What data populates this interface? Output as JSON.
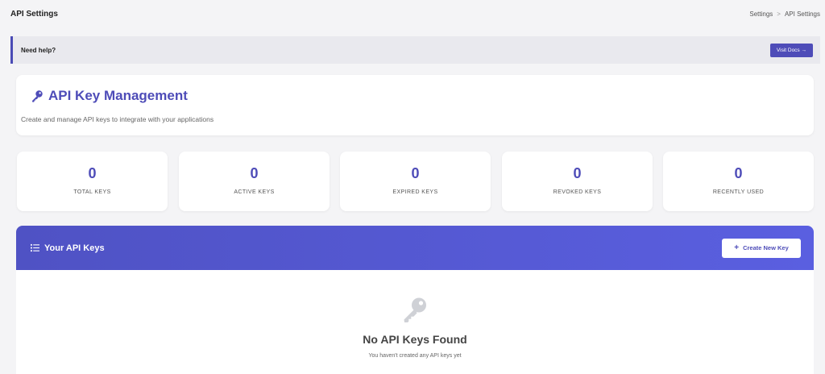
{
  "header": {
    "title": "API Settings",
    "breadcrumb": [
      "Settings",
      "API Settings"
    ],
    "breadcrumb_separator": ">"
  },
  "help": {
    "text": "Need help?",
    "docs_button": "Visit Docs →"
  },
  "management": {
    "icon": "key-icon",
    "title": "API Key Management",
    "subtitle": "Create and manage API keys to integrate with your applications"
  },
  "stats": [
    {
      "value": "0",
      "label": "TOTAL KEYS"
    },
    {
      "value": "0",
      "label": "ACTIVE KEYS"
    },
    {
      "value": "0",
      "label": "EXPIRED KEYS"
    },
    {
      "value": "0",
      "label": "REVOKED KEYS"
    },
    {
      "value": "0",
      "label": "RECENTLY USED"
    }
  ],
  "keys_panel": {
    "icon": "list-icon",
    "title": "Your API Keys",
    "create_button": "Create New Key",
    "empty_icon": "key-icon",
    "empty_title": "No API Keys Found",
    "empty_subtitle": "You haven't created any API keys yet"
  },
  "colors": {
    "accent": "#4e4cb8",
    "header_gradient_start": "#4f52c4",
    "header_gradient_end": "#5a5fe0",
    "page_bg": "#f4f4f6"
  }
}
